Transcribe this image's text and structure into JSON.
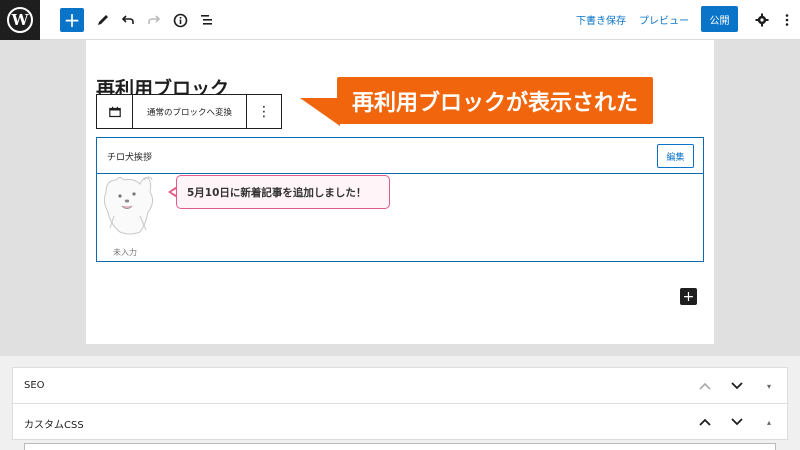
{
  "topbar": {
    "logo": "W",
    "icons": [
      "add-icon",
      "pencil-icon",
      "undo-icon",
      "redo-icon",
      "info-icon",
      "list-view-icon",
      "gear-icon",
      "more-vertical-icon"
    ],
    "add_label": "+",
    "save_draft": "下書き保存",
    "preview": "プレビュー",
    "publish": "公開"
  },
  "editor": {
    "title": "再利用ブロック",
    "block_toolbar": {
      "convert_label": "通常のブロックへ変換",
      "more_label": "⋮"
    },
    "reusable_block": {
      "name": "チロ犬挨拶",
      "edit_label": "編集",
      "speech_text": "5月10日に新着記事を追加しました！",
      "avatar_caption": "未入力"
    },
    "inserter_label": "+"
  },
  "annotation": {
    "callout_text": "再利用ブロックが表示された",
    "color": "#f1650c"
  },
  "metaboxes": [
    {
      "title": "SEO",
      "up": "⌃",
      "down": "⌄",
      "toggle": "▾"
    },
    {
      "title": "カスタムCSS",
      "up": "⌃",
      "down": "⌄",
      "toggle": "▴"
    }
  ],
  "colors": {
    "accent": "#0a74c9",
    "speech_border": "#e05a8a"
  }
}
